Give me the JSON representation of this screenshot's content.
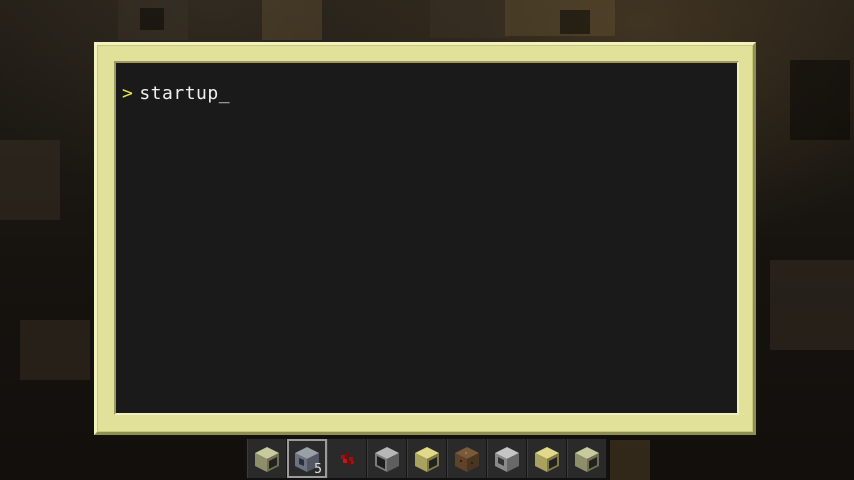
{
  "terminal": {
    "prompt_symbol": ">",
    "command": "startup",
    "cursor": "_"
  },
  "colors": {
    "frame": "#e1e19a",
    "screen": "#1a1a1a",
    "prompt": "#e6e64d",
    "text": "#f0f0f0"
  },
  "hotbar": {
    "selected_index": 1,
    "slots": [
      {
        "icon": "computer-block-icon",
        "count": ""
      },
      {
        "icon": "disk-drive-icon",
        "count": "5"
      },
      {
        "icon": "redstone-dust-icon",
        "count": ""
      },
      {
        "icon": "monitor-block-icon",
        "count": ""
      },
      {
        "icon": "advanced-computer-block-icon",
        "count": ""
      },
      {
        "icon": "dirt-block-icon",
        "count": ""
      },
      {
        "icon": "turtle-block-icon",
        "count": ""
      },
      {
        "icon": "advanced-computer-block-icon",
        "count": ""
      },
      {
        "icon": "computer-block-icon",
        "count": ""
      }
    ]
  }
}
